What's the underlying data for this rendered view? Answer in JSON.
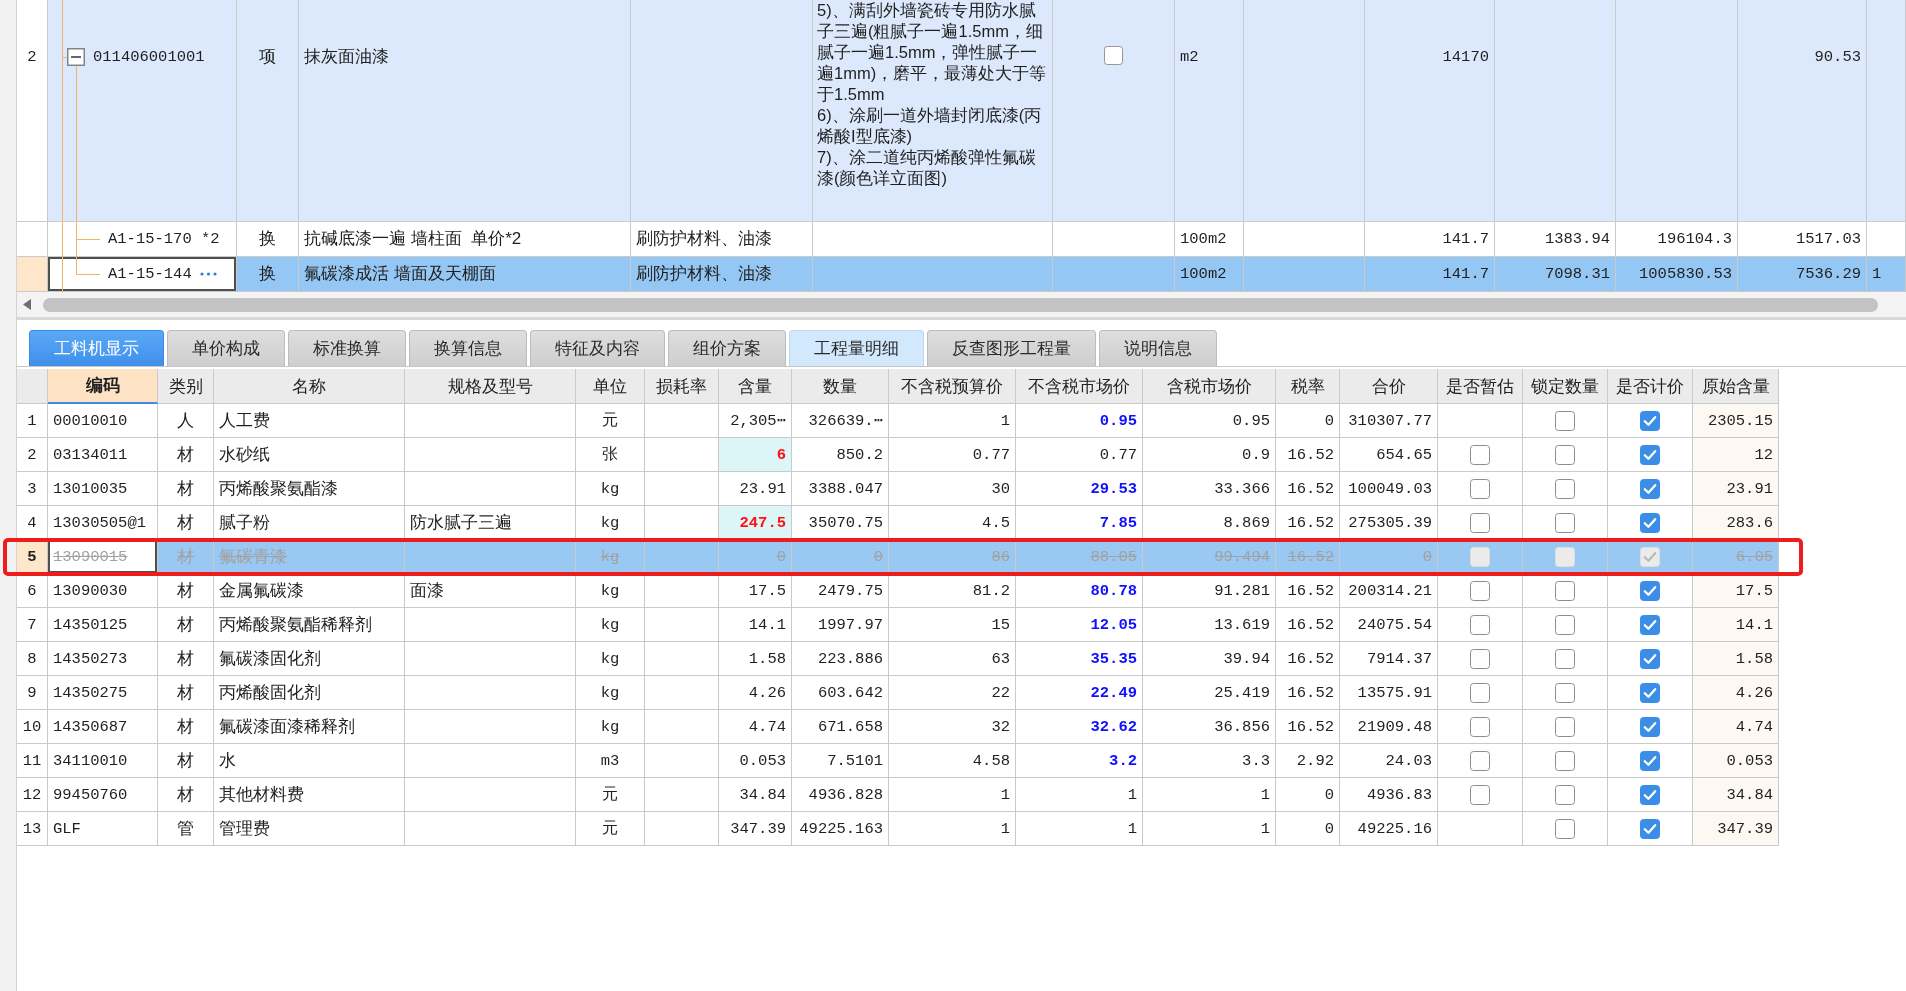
{
  "top_table": {
    "rows": [
      {
        "row_number": "2",
        "column_2": "011406001001",
        "expanded": true,
        "column_3": "项",
        "column_4": "抹灰面油漆",
        "column_6": "5)、满刮外墙瓷砖专用防水腻子三遍(粗腻子一遍1.5mm，细腻子一遍1.5mm，弹性腻子一遍1mm)，磨平，最薄处大于等于1.5mm\n6)、涂刷一道外墙封闭底漆(丙烯酸I型底漆)\n7)、涂二道纯丙烯酸弹性氟碳漆(颜色详立面图)",
        "checked": false,
        "column_8": "m2",
        "column_10": "14170",
        "column_13": "90.53",
        "selected": false,
        "children": [
          {
            "column_2": "A1-15-170 *2",
            "column_3": "换",
            "column_4": "抗碱底漆一遍 墙柱面  单价*2",
            "column_5": "刷防护材料、油漆",
            "column_8": "100m2",
            "column_10": "141.7",
            "column_11": "1383.94",
            "column_12": "196104.3",
            "column_13": "1517.03",
            "selected": false
          },
          {
            "column_2": "A1-15-144",
            "column_3": "换",
            "column_4": "氟碳漆成活 墙面及天棚面",
            "column_5": "刷防护材料、油漆",
            "column_8": "100m2",
            "column_10": "141.7",
            "column_11": "7098.31",
            "column_12": "1005830.53",
            "column_13": "7536.29",
            "column_14": "1",
            "selected": true
          }
        ]
      }
    ]
  },
  "tabs": [
    {
      "label": "工料机显示",
      "selected": true,
      "hovered": false
    },
    {
      "label": "单价构成",
      "selected": false,
      "hovered": false
    },
    {
      "label": "标准换算",
      "selected": false,
      "hovered": false
    },
    {
      "label": "换算信息",
      "selected": false,
      "hovered": false
    },
    {
      "label": "特征及内容",
      "selected": false,
      "hovered": false
    },
    {
      "label": "组价方案",
      "selected": false,
      "hovered": false
    },
    {
      "label": "工程量明细",
      "selected": false,
      "hovered": true
    },
    {
      "label": "反查图形工程量",
      "selected": false,
      "hovered": false
    },
    {
      "label": "说明信息",
      "selected": false,
      "hovered": false
    }
  ],
  "material_table": {
    "columns": [
      {
        "label": "编码",
        "selected": true
      },
      {
        "label": "类别",
        "selected": false
      },
      {
        "label": "名称",
        "selected": false
      },
      {
        "label": "规格及型号",
        "selected": false
      },
      {
        "label": "单位",
        "selected": false
      },
      {
        "label": "损耗率",
        "selected": false
      },
      {
        "label": "含量",
        "selected": false
      },
      {
        "label": "数量",
        "selected": false
      },
      {
        "label": "不含税预算价",
        "selected": false
      },
      {
        "label": "不含税市场价",
        "selected": false
      },
      {
        "label": "含税市场价",
        "selected": false
      },
      {
        "label": "税率",
        "selected": false
      },
      {
        "label": "合价",
        "selected": false
      },
      {
        "label": "是否暂估",
        "selected": false
      },
      {
        "label": "锁定数量",
        "selected": false
      },
      {
        "label": "是否计价",
        "selected": false
      },
      {
        "label": "原始含量",
        "selected": false
      }
    ],
    "rows": [
      {
        "row_number": "1",
        "code": "00010010",
        "category": "人",
        "name": "人工费",
        "unit": "元",
        "content": "2,305⋯",
        "quantity": "326639.⋯",
        "budget_price": "1",
        "market_price": "0.95",
        "tax_market_price": "0.95",
        "tax_rate": "0",
        "total": "310307.77",
        "quantity_locked": false,
        "priced": true,
        "original_content": "2305.15",
        "content_edited": false,
        "price_adjusted": true,
        "selected": false,
        "disabled": false,
        "marked": false
      },
      {
        "row_number": "2",
        "code": "03134011",
        "category": "材",
        "name": "水砂纸",
        "unit": "张",
        "content": "6",
        "quantity": "850.2",
        "budget_price": "0.77",
        "market_price": "0.77",
        "tax_market_price": "0.9",
        "tax_rate": "16.52",
        "total": "654.65",
        "provisional": false,
        "quantity_locked": false,
        "priced": true,
        "original_content": "12",
        "content_edited": true,
        "price_adjusted": false,
        "selected": false,
        "disabled": false,
        "marked": false
      },
      {
        "row_number": "3",
        "code": "13010035",
        "category": "材",
        "name": "丙烯酸聚氨酯漆",
        "unit": "kg",
        "content": "23.91",
        "quantity": "3388.047",
        "budget_price": "30",
        "market_price": "29.53",
        "tax_market_price": "33.366",
        "tax_rate": "16.52",
        "total": "100049.03",
        "provisional": false,
        "quantity_locked": false,
        "priced": true,
        "original_content": "23.91",
        "content_edited": false,
        "price_adjusted": true,
        "selected": false,
        "disabled": false,
        "marked": false
      },
      {
        "row_number": "4",
        "code": "13030505@1",
        "category": "材",
        "name": "腻子粉",
        "spec": "防水腻子三遍",
        "unit": "kg",
        "content": "247.5",
        "quantity": "35070.75",
        "budget_price": "4.5",
        "market_price": "7.85",
        "tax_market_price": "8.869",
        "tax_rate": "16.52",
        "total": "275305.39",
        "provisional": false,
        "quantity_locked": false,
        "priced": true,
        "original_content": "283.6",
        "content_edited": true,
        "price_adjusted": true,
        "selected": false,
        "disabled": false,
        "marked": false
      },
      {
        "row_number": "5",
        "code": "13090015",
        "category": "材",
        "name": "氟碳青漆",
        "unit": "kg",
        "content": "0",
        "quantity": "0",
        "budget_price": "86",
        "market_price": "88.05",
        "tax_market_price": "99.494",
        "tax_rate": "16.52",
        "total": "0",
        "provisional": false,
        "quantity_locked": false,
        "priced": true,
        "original_content": "6.05",
        "content_edited": false,
        "price_adjusted": false,
        "selected": true,
        "disabled": true,
        "marked": true
      },
      {
        "row_number": "6",
        "code": "13090030",
        "category": "材",
        "name": "金属氟碳漆",
        "spec": "面漆",
        "unit": "kg",
        "content": "17.5",
        "quantity": "2479.75",
        "budget_price": "81.2",
        "market_price": "80.78",
        "tax_market_price": "91.281",
        "tax_rate": "16.52",
        "total": "200314.21",
        "provisional": false,
        "quantity_locked": false,
        "priced": true,
        "original_content": "17.5",
        "content_edited": false,
        "price_adjusted": true,
        "selected": false,
        "disabled": false,
        "marked": false
      },
      {
        "row_number": "7",
        "code": "14350125",
        "category": "材",
        "name": "丙烯酸聚氨酯稀释剂",
        "unit": "kg",
        "content": "14.1",
        "quantity": "1997.97",
        "budget_price": "15",
        "market_price": "12.05",
        "tax_market_price": "13.619",
        "tax_rate": "16.52",
        "total": "24075.54",
        "provisional": false,
        "quantity_locked": false,
        "priced": true,
        "original_content": "14.1",
        "content_edited": false,
        "price_adjusted": true,
        "selected": false,
        "disabled": false,
        "marked": false
      },
      {
        "row_number": "8",
        "code": "14350273",
        "category": "材",
        "name": "氟碳漆固化剂",
        "unit": "kg",
        "content": "1.58",
        "quantity": "223.886",
        "budget_price": "63",
        "market_price": "35.35",
        "tax_market_price": "39.94",
        "tax_rate": "16.52",
        "total": "7914.37",
        "provisional": false,
        "quantity_locked": false,
        "priced": true,
        "original_content": "1.58",
        "content_edited": false,
        "price_adjusted": true,
        "selected": false,
        "disabled": false,
        "marked": false
      },
      {
        "row_number": "9",
        "code": "14350275",
        "category": "材",
        "name": "丙烯酸固化剂",
        "unit": "kg",
        "content": "4.26",
        "quantity": "603.642",
        "budget_price": "22",
        "market_price": "22.49",
        "tax_market_price": "25.419",
        "tax_rate": "16.52",
        "total": "13575.91",
        "provisional": false,
        "quantity_locked": false,
        "priced": true,
        "original_content": "4.26",
        "content_edited": false,
        "price_adjusted": true,
        "selected": false,
        "disabled": false,
        "marked": false
      },
      {
        "row_number": "10",
        "code": "14350687",
        "category": "材",
        "name": "氟碳漆面漆稀释剂",
        "unit": "kg",
        "content": "4.74",
        "quantity": "671.658",
        "budget_price": "32",
        "market_price": "32.62",
        "tax_market_price": "36.856",
        "tax_rate": "16.52",
        "total": "21909.48",
        "provisional": false,
        "quantity_locked": false,
        "priced": true,
        "original_content": "4.74",
        "content_edited": false,
        "price_adjusted": true,
        "selected": false,
        "disabled": false,
        "marked": false
      },
      {
        "row_number": "11",
        "code": "34110010",
        "category": "材",
        "name": "水",
        "unit": "m3",
        "content": "0.053",
        "quantity": "7.5101",
        "budget_price": "4.58",
        "market_price": "3.2",
        "tax_market_price": "3.3",
        "tax_rate": "2.92",
        "total": "24.03",
        "provisional": false,
        "quantity_locked": false,
        "priced": true,
        "original_content": "0.053",
        "content_edited": false,
        "price_adjusted": true,
        "selected": false,
        "disabled": false,
        "marked": false
      },
      {
        "row_number": "12",
        "code": "99450760",
        "category": "材",
        "name": "其他材料费",
        "unit": "元",
        "content": "34.84",
        "quantity": "4936.828",
        "budget_price": "1",
        "market_price": "1",
        "tax_market_price": "1",
        "tax_rate": "0",
        "total": "4936.83",
        "provisional": false,
        "quantity_locked": false,
        "priced": true,
        "original_content": "34.84",
        "content_edited": false,
        "price_adjusted": false,
        "selected": false,
        "disabled": false,
        "marked": false
      },
      {
        "row_number": "13",
        "code": "GLF",
        "category": "管",
        "name": "管理费",
        "unit": "元",
        "content": "347.39",
        "quantity": "49225.163",
        "budget_price": "1",
        "market_price": "1",
        "tax_market_price": "1",
        "tax_rate": "0",
        "total": "49225.16",
        "quantity_locked": false,
        "priced": true,
        "original_content": "347.39",
        "content_edited": false,
        "price_adjusted": false,
        "selected": false,
        "disabled": false,
        "marked": false
      }
    ]
  }
}
